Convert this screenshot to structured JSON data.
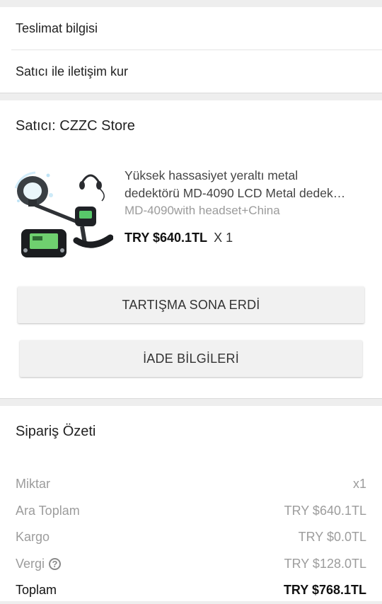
{
  "links": {
    "delivery_info": "Teslimat bilgisi",
    "contact_seller": "Satıcı ile iletişim kur"
  },
  "seller": {
    "title": "Satıcı: CZZC Store"
  },
  "product": {
    "title_line1": "Yüksek hassasiyet yeraltı metal",
    "title_line2": "dedektörü MD-4090 LCD Metal dedek…",
    "variant": "MD-4090with headset+China",
    "price": "TRY $640.1TL",
    "quantity": "X 1"
  },
  "actions": {
    "discussion_label": "TARTIŞMA SONA ERDİ",
    "refund_label": "İADE BİLGİLERİ"
  },
  "summary": {
    "title": "Sipariş Özeti",
    "rows": [
      {
        "label": "Miktar",
        "value": "x1"
      },
      {
        "label": "Ara Toplam",
        "value": "TRY $640.1TL"
      },
      {
        "label": "Kargo",
        "value": "TRY $0.0TL"
      },
      {
        "label": "Vergi",
        "value": "TRY $128.0TL"
      },
      {
        "label": "Toplam",
        "value": "TRY $768.1TL"
      }
    ]
  },
  "icons": {
    "tax_help": "help-circle-icon",
    "help_glyph": "?"
  }
}
